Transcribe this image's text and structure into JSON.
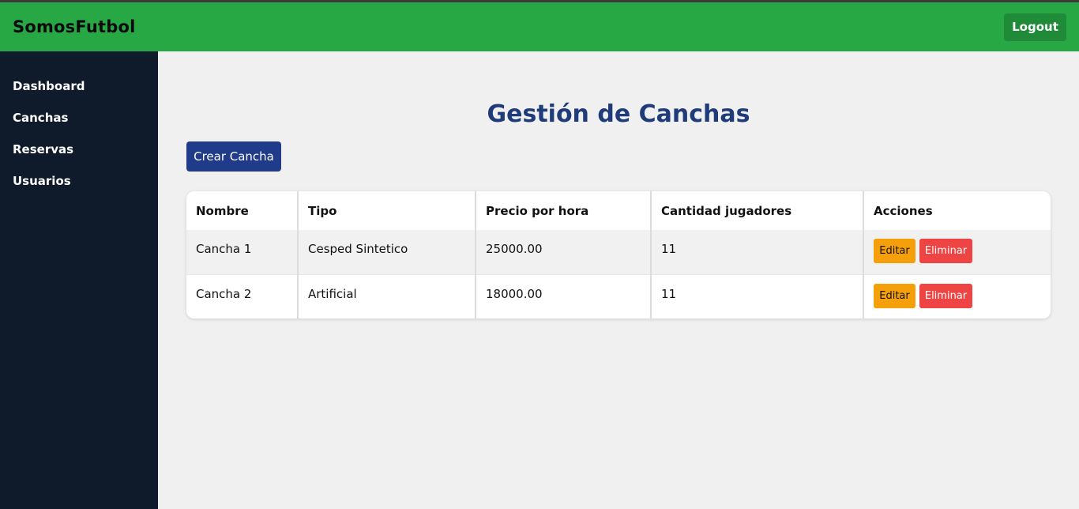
{
  "header": {
    "brand": "SomosFutbol",
    "logout_label": "Logout"
  },
  "sidebar": {
    "items": [
      {
        "label": "Dashboard"
      },
      {
        "label": "Canchas"
      },
      {
        "label": "Reservas"
      },
      {
        "label": "Usuarios"
      }
    ]
  },
  "main": {
    "title": "Gestión de Canchas",
    "create_label": "Crear Cancha",
    "table": {
      "headers": [
        "Nombre",
        "Tipo",
        "Precio por hora",
        "Cantidad jugadores",
        "Acciones"
      ],
      "rows": [
        {
          "nombre": "Cancha 1",
          "tipo": "Cesped Sintetico",
          "precio": "25000.00",
          "cantidad": "11",
          "edit_label": "Editar",
          "delete_label": "Eliminar"
        },
        {
          "nombre": "Cancha 2",
          "tipo": "Artificial",
          "precio": "18000.00",
          "cantidad": "11",
          "edit_label": "Editar",
          "delete_label": "Eliminar"
        }
      ]
    }
  },
  "colors": {
    "header_bg": "#28a745",
    "sidebar_bg": "#0f1b2b",
    "title": "#1f3b7a",
    "primary_button": "#1f3b8a",
    "edit_button": "#f5a00a",
    "delete_button": "#ee4444"
  }
}
